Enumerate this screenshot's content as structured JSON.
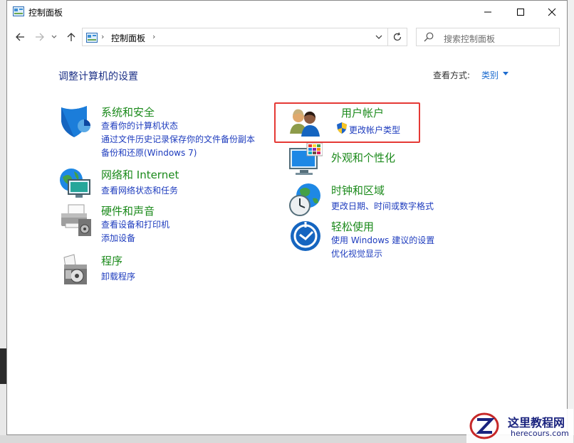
{
  "window": {
    "title": "控制面板"
  },
  "navigation": {
    "breadcrumb": [
      "控制面板"
    ],
    "search_placeholder": "搜索控制面板"
  },
  "header": {
    "heading": "调整计算机的设置",
    "view_by_label": "查看方式:",
    "view_by_value": "类别"
  },
  "categories": [
    {
      "title": "系统和安全",
      "links": [
        "查看你的计算机状态",
        "通过文件历史记录保存你的文件备份副本",
        "备份和还原(Windows 7)"
      ],
      "icon": "shield-icon"
    },
    {
      "title": "网络和 Internet",
      "links": [
        "查看网络状态和任务"
      ],
      "icon": "network-globe-icon"
    },
    {
      "title": "硬件和声音",
      "links": [
        "查看设备和打印机",
        "添加设备"
      ],
      "icon": "printer-icon"
    },
    {
      "title": "程序",
      "links": [
        "卸载程序"
      ],
      "icon": "programs-icon"
    },
    {
      "title": "用户帐户",
      "links": [
        "更改帐户类型"
      ],
      "icon": "users-icon"
    },
    {
      "title": "外观和个性化",
      "links": [],
      "icon": "monitor-palette-icon"
    },
    {
      "title": "时钟和区域",
      "links": [
        "更改日期、时间或数字格式"
      ],
      "icon": "clock-globe-icon"
    },
    {
      "title": "轻松使用",
      "links": [
        "使用 Windows 建议的设置",
        "优化视觉显示"
      ],
      "icon": "ease-of-access-icon"
    }
  ],
  "watermark": {
    "name": "这里教程网",
    "url": "herecours.com"
  },
  "colors": {
    "title_green": "#1b8a1b",
    "link_blue": "#1e3cbe",
    "heading_blue": "#1e3287",
    "highlight_red": "#e53935"
  }
}
